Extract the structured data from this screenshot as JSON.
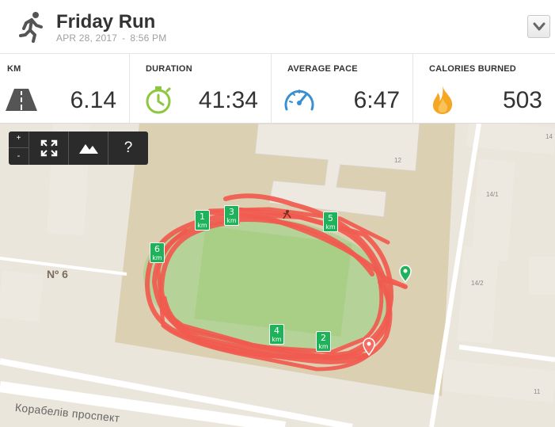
{
  "activity": {
    "title": "Friday Run",
    "date": "APR 28, 2017",
    "date_sep": "-",
    "time": "8:56 PM"
  },
  "stats": [
    {
      "label": "KM",
      "value": "6.14",
      "icon": "road-icon"
    },
    {
      "label": "DURATION",
      "value": "41:34",
      "icon": "stopwatch-icon"
    },
    {
      "label": "AVERAGE PACE",
      "value": "6:47",
      "icon": "speedometer-icon"
    },
    {
      "label": "CALORIES BURNED",
      "value": "503",
      "icon": "flame-icon"
    }
  ],
  "map": {
    "toolbar": {
      "zoom_in": "+",
      "zoom_out": "-",
      "help": "?"
    },
    "km_unit": "km",
    "markers": [
      "1",
      "2",
      "3",
      "4",
      "5",
      "6"
    ],
    "labels": {
      "building_12": "12",
      "building_14": "14",
      "building_14_1": "14/1",
      "building_14_2": "14/2",
      "building_11": "11",
      "building_no6": "Nº 6",
      "street": "Корабелів проспект"
    }
  },
  "colors": {
    "route": "#f15a4f",
    "marker": "#1eb35a",
    "field": "#a8cf85",
    "stadium": "#d9cfb3",
    "accent_icon": "#3a8fd1",
    "flame": "#f5a623"
  }
}
